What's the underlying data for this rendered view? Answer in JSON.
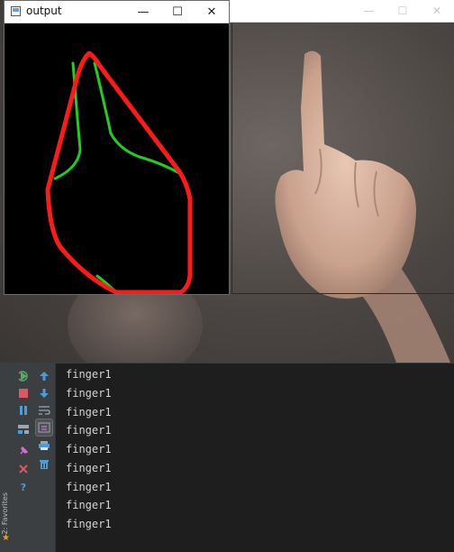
{
  "output_window": {
    "title": "output",
    "controls": {
      "minimize": "—",
      "maximize": "☐",
      "close": "✕"
    }
  },
  "camera_window": {
    "controls": {
      "minimize": "—",
      "maximize": "☐",
      "close": "✕"
    }
  },
  "colors": {
    "hull": "#ff1a1a",
    "contour": "#22cc22",
    "camera_border": "#1414d8",
    "console_bg": "#1e1e1e",
    "console_text": "#d4d4d4"
  },
  "ide": {
    "favorites_label": "2: Favorites",
    "tools_left": [
      {
        "name": "rerun-icon",
        "color": "#59a869"
      },
      {
        "name": "stop-icon",
        "color": "#db5860"
      },
      {
        "name": "pause-icon",
        "color": "#4b9cd9"
      },
      {
        "name": "dump-threads-icon",
        "color": "#9aa7b0"
      },
      {
        "name": "pin-icon",
        "color": "#d56fd6"
      },
      {
        "name": "close-icon",
        "color": "#db5860"
      },
      {
        "name": "help-icon",
        "color": "#4b9cd9"
      }
    ],
    "tools_right": [
      {
        "name": "up-arrow-icon",
        "color": "#4b9cd9"
      },
      {
        "name": "down-arrow-icon",
        "color": "#4b9cd9"
      },
      {
        "name": "soft-wrap-icon",
        "color": "#9aa7b0"
      },
      {
        "name": "scroll-to-end-icon",
        "color": "#9aa7b0"
      },
      {
        "name": "print-icon",
        "color": "#4b9cd9"
      },
      {
        "name": "trash-icon",
        "color": "#4b9cd9"
      }
    ],
    "console_lines": [
      "finger1",
      "finger1",
      "finger1",
      "finger1",
      "finger1",
      "finger1",
      "finger1",
      "finger1",
      "finger1"
    ]
  }
}
